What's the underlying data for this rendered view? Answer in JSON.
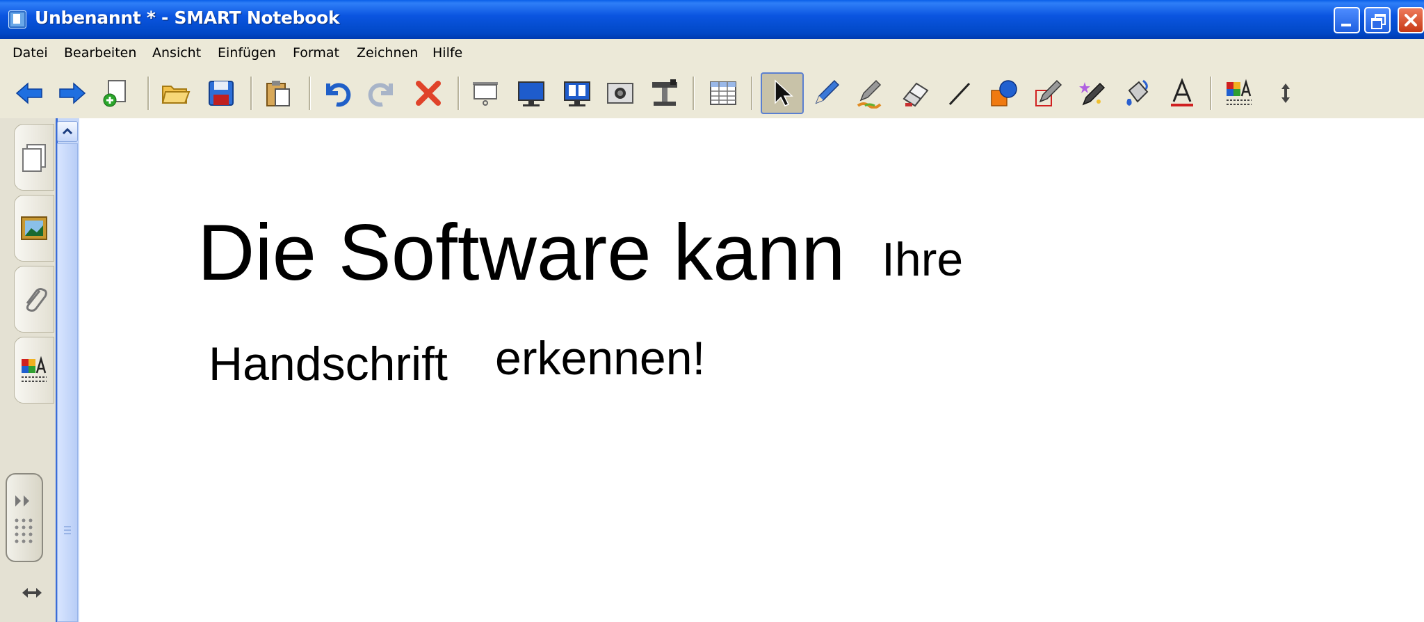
{
  "window": {
    "title": "Unbenannt * - SMART Notebook"
  },
  "menu": [
    {
      "label": "Datei"
    },
    {
      "label": "Bearbeiten"
    },
    {
      "label": "Ansicht"
    },
    {
      "label": "Einfügen"
    },
    {
      "label": "Format"
    },
    {
      "label": "Zeichnen"
    },
    {
      "label": "Hilfe"
    }
  ],
  "toolbar": {
    "icons": [
      "previous-page-icon",
      "next-page-icon",
      "add-page-icon",
      "open-file-icon",
      "save-icon",
      "paste-icon",
      "undo-icon",
      "redo-icon",
      "delete-icon",
      "screen-shade-icon",
      "full-screen-icon",
      "dual-page-icon",
      "screen-capture-icon",
      "document-camera-icon",
      "table-icon",
      "select-icon",
      "pen-icon",
      "creative-pen-icon",
      "eraser-icon",
      "line-icon",
      "shapes-icon",
      "shape-recognition-pen-icon",
      "magic-pen-icon",
      "fill-icon",
      "text-icon",
      "properties-icon",
      "move-toolbar-icon"
    ],
    "active_tool": "select"
  },
  "side_tabs": [
    "page-sorter-icon",
    "gallery-icon",
    "attachments-icon",
    "properties-icon"
  ],
  "canvas": {
    "ink_text": [
      {
        "text": "Die Software kann"
      },
      {
        "text": "Ihre"
      },
      {
        "text": "Handschrift"
      },
      {
        "text": "erkennen!"
      }
    ]
  },
  "colors": {
    "titlebar": "#0148c6",
    "chrome": "#ece9d8",
    "scrollbar": "#c7d8f8",
    "canvas": "#ffffff"
  }
}
